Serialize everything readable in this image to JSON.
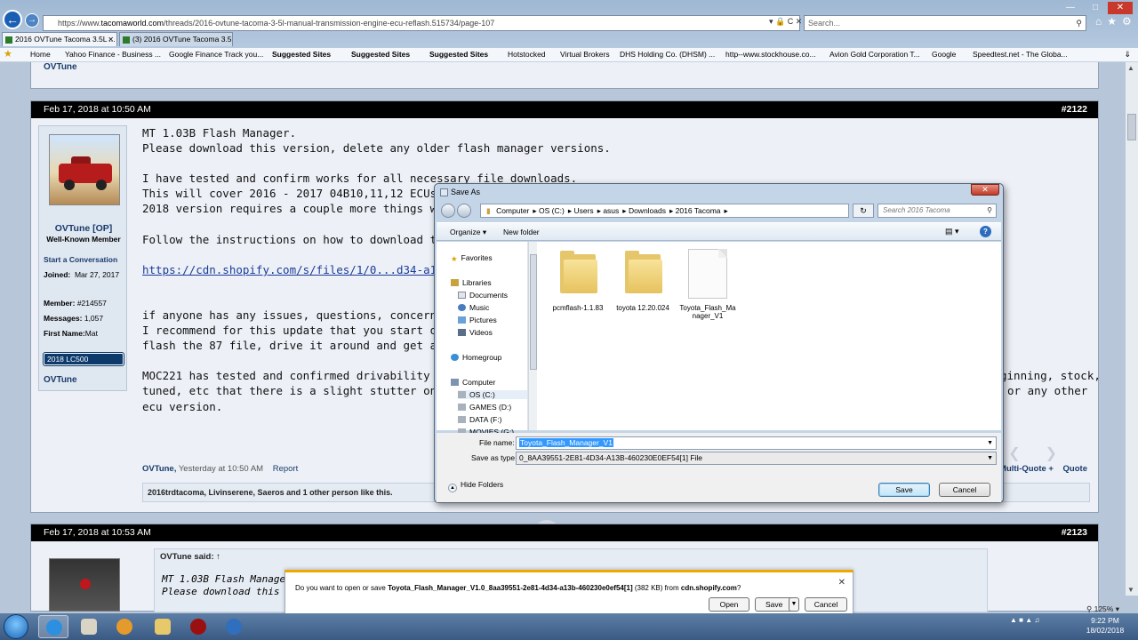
{
  "browser": {
    "url_prefix": "https://www.",
    "url_host": "tacomaworld.com",
    "url_path": "/threads/2016-ovtune-tacoma-3-5l-manual-transmission-engine-ecu-reflash.515734/page-107",
    "search_placeholder": "Search...",
    "tabs": [
      {
        "label": "2016 OVTune Tacoma 3.5L ..."
      },
      {
        "label": "(3) 2016 OVTune Tacoma 3.5L ..."
      }
    ],
    "favorites": [
      {
        "label": "Home"
      },
      {
        "label": "Yahoo Finance - Business ..."
      },
      {
        "label": "Google Finance Track you..."
      },
      {
        "label": "Suggested Sites"
      },
      {
        "label": "Suggested Sites"
      },
      {
        "label": "Suggested Sites"
      },
      {
        "label": "Hotstocked"
      },
      {
        "label": "Virtual Brokers"
      },
      {
        "label": "DHS Holding Co. (DHSM) ..."
      },
      {
        "label": "http--www.stockhouse.co..."
      },
      {
        "label": "Avion Gold Corporation T..."
      },
      {
        "label": "Google"
      },
      {
        "label": "Speedtest.net - The Globa..."
      }
    ],
    "zoom": "125%"
  },
  "prev_post": {
    "sig": "OVTune"
  },
  "post1": {
    "date": "Feb 17, 2018 at 10:50 AM",
    "number": "#2122",
    "user": {
      "name": "OVTune [OP]",
      "title": "Well-Known Member",
      "start_conversation": "Start a Conversation",
      "joined_label": "Joined:",
      "joined": "Mar 27, 2017",
      "member_label": "Member:",
      "member": "#214557",
      "messages_label": "Messages:",
      "messages": "1,057",
      "firstname_label": "First Name:",
      "firstname": "Mat",
      "badge": "2018 LC500",
      "signature": "OVTune"
    },
    "lines": [
      "MT 1.03B Flash Manager.",
      "Please download this version, delete any older flash manager versions.",
      "I have tested and confirm works for all necessary file downloads.",
      "This will cover 2016 - 2017 04B10,11,12 ECUs.",
      "2018 version requires a couple more things which I sl",
      "Follow the instructions on how to download the files (",
      "https://cdn.shopify.com/s/files/1/0...d34-a13b-46023",
      "if anyone has any issues, questions, concerns, etc ple",
      "I recommend for this update that you start on the 87",
      "flash the 87 file, drive it around and get a feel for it, a",
      "MOC221 has tested and confirmed drivability with 1.0",
      "tuned, etc that there is a slight stutter on his truck (e",
      "ecu version."
    ],
    "right_text_1": "ginning, stock,",
    "right_text_2": "or any other",
    "footer_user": "OVTune,",
    "footer_time": "Yesterday at 10:50 AM",
    "report": "Report",
    "multi_quote": "Multi-Quote +",
    "quote": "Quote",
    "likes": "2016trdtacoma, Livinserene, Saeros and 1 other person like this."
  },
  "post2": {
    "date": "Feb 17, 2018 at 10:53 AM",
    "number": "#2123",
    "said": "OVTune said: ↑",
    "q1": "MT 1.03B Flash Manager.",
    "q2": "Please download this versio"
  },
  "save_dialog": {
    "title": "Save As",
    "breadcrumb": [
      "Computer",
      "OS (C:)",
      "Users",
      "asus",
      "Downloads",
      "2016 Tacoma"
    ],
    "search_placeholder": "Search 2016 Tacoma",
    "organize": "Organize ▾",
    "new_folder": "New folder",
    "nav": [
      {
        "label": "Favorites"
      },
      {
        "label": "Libraries"
      },
      {
        "label": "Documents"
      },
      {
        "label": "Music"
      },
      {
        "label": "Pictures"
      },
      {
        "label": "Videos"
      },
      {
        "label": "Homegroup"
      },
      {
        "label": "Computer"
      },
      {
        "label": "OS (C:)"
      },
      {
        "label": "GAMES (D:)"
      },
      {
        "label": "DATA (F:)"
      },
      {
        "label": "MOVIES (G:)"
      }
    ],
    "files": [
      {
        "name": "pcmflash-1.1.83",
        "kind": "folder"
      },
      {
        "name": "toyota 12.20.024",
        "kind": "folder"
      },
      {
        "name": "Toyota_Flash_Ma nager_V1",
        "kind": "file"
      }
    ],
    "file_name_label": "File name:",
    "file_name": "Toyota_Flash_Manager_V1",
    "save_type_label": "Save as type:",
    "save_type": "0_8AA39551-2E81-4D34-A13B-460230E0EF54[1] File",
    "hide_folders": "Hide Folders",
    "save": "Save",
    "cancel": "Cancel"
  },
  "download_bar": {
    "prefix": "Do you want to open or save ",
    "filename": "Toyota_Flash_Manager_V1.0_8aa39551-2e81-4d34-a13b-460230e0ef54[1]",
    "size": " (382 KB) from ",
    "host": "cdn.shopify.com",
    "suffix": "?",
    "open": "Open",
    "save": "Save",
    "cancel": "Cancel"
  },
  "taskbar": {
    "time": "9:22 PM",
    "date": "18/02/2018"
  }
}
